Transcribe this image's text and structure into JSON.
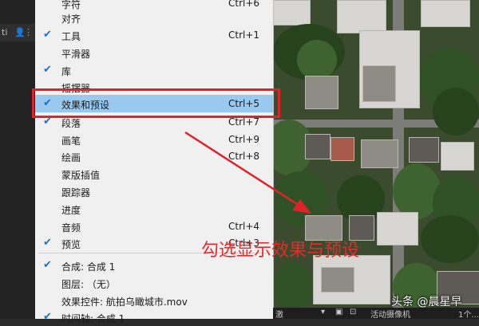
{
  "left_panel": {
    "label": "ti",
    "icon1": "person-icon",
    "icon2": "grip-icon"
  },
  "menu": {
    "items": [
      {
        "label": "字符",
        "shortcut": "Ctrl+6",
        "checked": false
      },
      {
        "label": "对齐",
        "shortcut": "",
        "checked": false
      },
      {
        "label": "工具",
        "shortcut": "Ctrl+1",
        "checked": true
      },
      {
        "label": "平滑器",
        "shortcut": "",
        "checked": false
      },
      {
        "label": "库",
        "shortcut": "",
        "checked": true
      },
      {
        "label": "摇摆器",
        "shortcut": "",
        "checked": false
      },
      {
        "label": "效果和预设",
        "shortcut": "Ctrl+5",
        "checked": true
      },
      {
        "label": "段落",
        "shortcut": "Ctrl+7",
        "checked": true
      },
      {
        "label": "画笔",
        "shortcut": "Ctrl+9",
        "checked": false
      },
      {
        "label": "绘画",
        "shortcut": "Ctrl+8",
        "checked": false
      },
      {
        "label": "蒙版插值",
        "shortcut": "",
        "checked": false
      },
      {
        "label": "跟踪器",
        "shortcut": "",
        "checked": false
      },
      {
        "label": "进度",
        "shortcut": "",
        "checked": false
      },
      {
        "label": "音频",
        "shortcut": "Ctrl+4",
        "checked": false
      },
      {
        "label": "预览",
        "shortcut": "Ctrl+3",
        "checked": true
      },
      {
        "label": "合成: 合成 1",
        "shortcut": "",
        "checked": true
      },
      {
        "label": "图层: （无）",
        "shortcut": "",
        "checked": false
      },
      {
        "label": "效果控件: 航拍乌瞰城市.mov",
        "shortcut": "",
        "checked": false
      },
      {
        "label": "时间轴: 合成 1",
        "shortcut": "",
        "checked": true
      }
    ],
    "check_glyph": "✔"
  },
  "annotation": {
    "text": "勾选显示效果与预设",
    "color": "#e0232b"
  },
  "status_bar": {
    "s1": "激",
    "s2": "▾",
    "s3": "▣",
    "s4": "⊡",
    "s5": "活动摄像机",
    "s6": "1个..."
  },
  "watermark": {
    "prefix": "头条",
    "handle": "@晨星早"
  },
  "colors": {
    "highlight": "#99c9ef",
    "check": "#1f6fbf",
    "menu_bg": "#f0f0f0"
  }
}
